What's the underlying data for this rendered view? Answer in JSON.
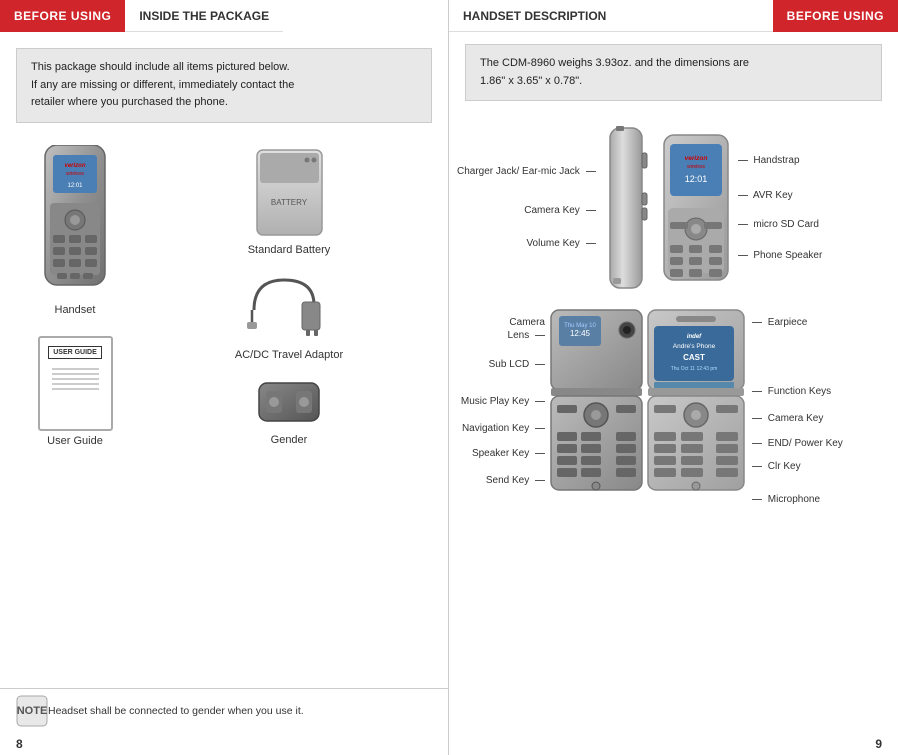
{
  "left_page": {
    "header_tab1": "BEFORE USING",
    "header_tab2": "INSIDE THE PACKAGE",
    "info_box": "This package should include all items pictured below.\nIf any are missing or different, immediately contact the\nretailer where you purchased the phone.",
    "items": [
      {
        "id": "handset",
        "label": "Handset"
      },
      {
        "id": "userguide",
        "label": "User Guide",
        "inner_label": "USER GUIDE"
      },
      {
        "id": "battery",
        "label": "Standard Battery"
      },
      {
        "id": "adaptor",
        "label": "AC/DC Travel Adaptor"
      },
      {
        "id": "gender",
        "label": "Gender"
      }
    ],
    "note": {
      "icon": "note-icon",
      "text": "Headset shall be connected to gender when you use it."
    },
    "page_number": "8"
  },
  "right_page": {
    "header_tab1": "HANDSET DESCRIPTION",
    "header_tab2": "BEFORE USING",
    "info_box": "The CDM-8960 weighs 3.93oz. and the dimensions are\n1.86\" x 3.65\" x 0.78\".",
    "top_diagram": {
      "labels_left": [
        {
          "id": "charger-jack",
          "text": "Charger Jack/\nEar-mic Jack"
        },
        {
          "id": "camera-key",
          "text": "Camera Key"
        },
        {
          "id": "volume-key",
          "text": "Volume Key"
        }
      ],
      "labels_right": [
        {
          "id": "handstrap",
          "text": "Handstrap"
        },
        {
          "id": "avr-key",
          "text": "AVR Key"
        },
        {
          "id": "micro-sd",
          "text": "micro SD\nCard"
        },
        {
          "id": "phone-speaker",
          "text": "Phone\nSpeaker"
        }
      ]
    },
    "bottom_diagram": {
      "labels_left": [
        {
          "id": "camera-lens",
          "text": "Camera\nLens"
        },
        {
          "id": "sub-lcd",
          "text": "Sub LCD"
        },
        {
          "id": "music-play-key",
          "text": "Music Play Key"
        },
        {
          "id": "navigation-key",
          "text": "Navigation Key"
        },
        {
          "id": "speaker-key",
          "text": "Speaker Key"
        },
        {
          "id": "send-key",
          "text": "Send Key"
        }
      ],
      "labels_right": [
        {
          "id": "earpiece",
          "text": "Earpiece"
        },
        {
          "id": "function-keys",
          "text": "Function Keys"
        },
        {
          "id": "camera-key2",
          "text": "Camera Key"
        },
        {
          "id": "end-power-key",
          "text": "END/\nPower Key"
        },
        {
          "id": "clr-key",
          "text": "Clr Key"
        },
        {
          "id": "microphone",
          "text": "Microphone"
        }
      ]
    },
    "page_number": "9"
  }
}
